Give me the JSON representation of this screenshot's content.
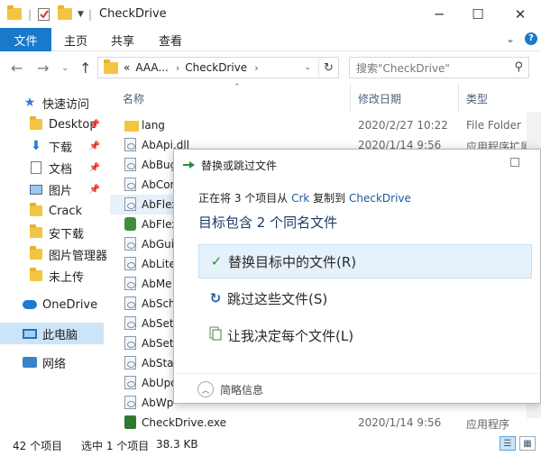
{
  "window": {
    "title": "CheckDrive",
    "controls": [
      "─",
      "☐",
      "✕"
    ]
  },
  "ribbon": {
    "tabs": [
      "文件",
      "主页",
      "共享",
      "查看"
    ],
    "help": "?"
  },
  "address": {
    "crumbs": [
      "«",
      "AAA...",
      "›",
      "CheckDrive",
      "›"
    ],
    "search_placeholder": "搜索\"CheckDrive\""
  },
  "nav": {
    "items": [
      {
        "label": "快速访问",
        "icon": "star-icon"
      },
      {
        "label": "Desktop",
        "icon": "folder-icon",
        "pinned": true
      },
      {
        "label": "下载",
        "icon": "download-icon",
        "pinned": true
      },
      {
        "label": "文档",
        "icon": "document-icon",
        "pinned": true
      },
      {
        "label": "图片",
        "icon": "picture-icon",
        "pinned": true
      },
      {
        "label": "Crack",
        "icon": "folder-icon"
      },
      {
        "label": "安下载",
        "icon": "folder-icon"
      },
      {
        "label": "图片管理器",
        "icon": "folder-icon"
      },
      {
        "label": "未上传",
        "icon": "folder-icon"
      },
      {
        "label": "OneDrive",
        "icon": "cloud-icon"
      },
      {
        "label": "此电脑",
        "icon": "computer-icon"
      },
      {
        "label": "网络",
        "icon": "network-icon"
      }
    ]
  },
  "list": {
    "columns": [
      "名称",
      "修改日期",
      "类型"
    ],
    "rows": [
      {
        "name": "lang",
        "date": "2020/2/27 10:22",
        "type": "File Folder",
        "icon": "folder"
      },
      {
        "name": "AbApi.dll",
        "date": "2020/1/14 9:56",
        "type": "应用程序扩展",
        "icon": "dll"
      },
      {
        "name": "AbBug",
        "date": "",
        "type": "",
        "icon": "dll"
      },
      {
        "name": "AbCor",
        "date": "",
        "type": "",
        "icon": "dll"
      },
      {
        "name": "AbFlex",
        "date": "",
        "type": "",
        "icon": "dll"
      },
      {
        "name": "AbFlex",
        "date": "",
        "type": "",
        "icon": "green"
      },
      {
        "name": "AbGui",
        "date": "",
        "type": "",
        "icon": "dll"
      },
      {
        "name": "AbLite",
        "date": "",
        "type": "",
        "icon": "dll"
      },
      {
        "name": "AbMe",
        "date": "",
        "type": "",
        "icon": "dll"
      },
      {
        "name": "AbSch",
        "date": "",
        "type": "",
        "icon": "dll"
      },
      {
        "name": "AbSet",
        "date": "",
        "type": "",
        "icon": "dll"
      },
      {
        "name": "AbSet",
        "date": "",
        "type": "",
        "icon": "dll"
      },
      {
        "name": "AbSta",
        "date": "",
        "type": "",
        "icon": "dll"
      },
      {
        "name": "AbUpo",
        "date": "",
        "type": "",
        "icon": "dll"
      },
      {
        "name": "AbWp",
        "date": "",
        "type": "",
        "icon": "dll"
      },
      {
        "name": "CheckDrive.exe",
        "date": "2020/1/14 9:56",
        "type": "应用程序",
        "icon": "exe"
      }
    ]
  },
  "status": {
    "count": "42 个项目",
    "selected": "选中 1 个项目",
    "size": "38.3 KB"
  },
  "dialog": {
    "title": "替换或跳过文件",
    "status_prefix": "正在将 3 个项目从 ",
    "source": "Crk",
    "status_mid": " 复制到 ",
    "dest": "CheckDrive",
    "heading": "目标包含 2 个同名文件",
    "options": [
      {
        "label": "替换目标中的文件(R)",
        "icon": "checkmark-icon"
      },
      {
        "label": "跳过这些文件(S)",
        "icon": "skip-icon"
      },
      {
        "label": "让我决定每个文件(L)",
        "icon": "decide-icon"
      }
    ],
    "more": "简略信息"
  },
  "colors": {
    "accent": "#1979ca",
    "selection": "#cce4f7",
    "link": "#1a5a9e"
  }
}
